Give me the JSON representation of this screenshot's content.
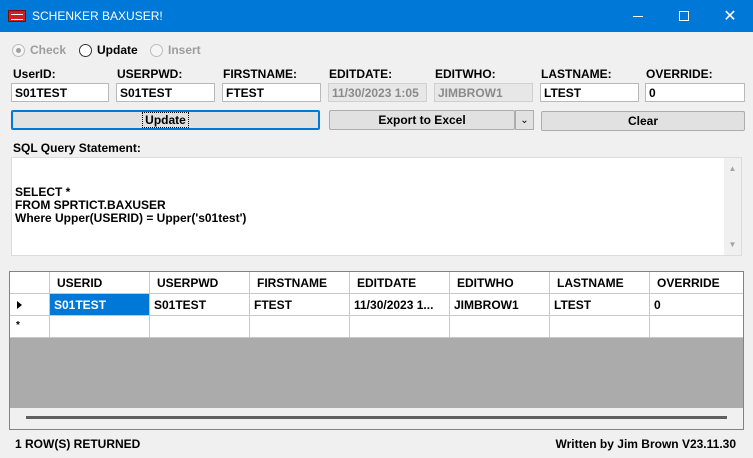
{
  "window": {
    "title": "SCHENKER BAXUSER!",
    "close_glyph": "✕"
  },
  "modes": [
    {
      "label": "Check",
      "selected": true,
      "enabled": false
    },
    {
      "label": "Update",
      "selected": false,
      "enabled": true
    },
    {
      "label": "Insert",
      "selected": false,
      "enabled": false
    }
  ],
  "fields": {
    "userid": {
      "label": "UserID:",
      "value": "S01TEST"
    },
    "userpwd": {
      "label": "USERPWD:",
      "value": "S01TEST"
    },
    "firstname": {
      "label": "FIRSTNAME:",
      "value": "FTEST"
    },
    "editdate": {
      "label": "EDITDATE:",
      "value": "11/30/2023 1:05"
    },
    "editwho": {
      "label": "EDITWHO:",
      "value": "JIMBROW1"
    },
    "lastname": {
      "label": "LASTNAME:",
      "value": "LTEST"
    },
    "override": {
      "label": "OVERRIDE:",
      "value": "0"
    }
  },
  "buttons": {
    "update": "Update",
    "export": "Export to Excel",
    "export_dropdown": "⌄",
    "clear": "Clear"
  },
  "sql": {
    "label": "SQL Query Statement:",
    "text": "SELECT *\nFROM SPRTICT.BAXUSER\nWhere Upper(USERID) = Upper('s01test')"
  },
  "grid": {
    "columns": [
      "USERID",
      "USERPWD",
      "FIRSTNAME",
      "EDITDATE",
      "EDITWHO",
      "LASTNAME",
      "OVERRIDE"
    ],
    "rows": [
      [
        "S01TEST",
        "S01TEST",
        "FTEST",
        "11/30/2023 1...",
        "JIMBROW1",
        "LTEST",
        "0"
      ]
    ],
    "new_row_marker": "*"
  },
  "status": {
    "rows_returned": "1 ROW(S) RETURNED",
    "credit": "Written by Jim Brown V23.11.30"
  }
}
